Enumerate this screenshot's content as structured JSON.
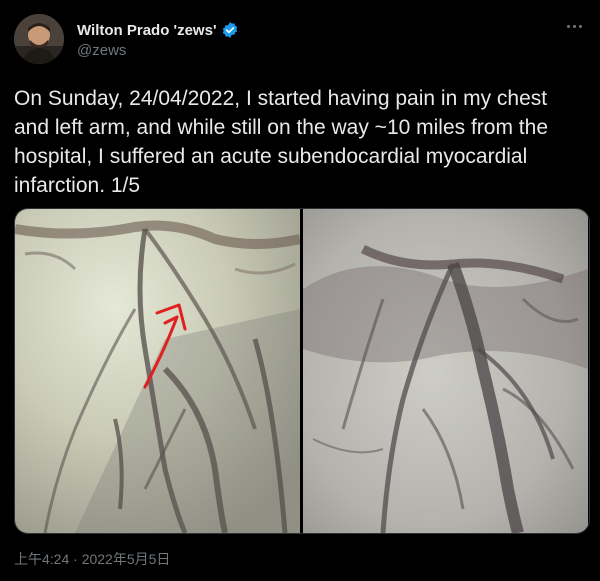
{
  "tweet": {
    "author": {
      "display_name": "Wilton Prado 'zews'",
      "handle": "@zews",
      "verified": true,
      "avatar_icon": "profile-avatar"
    },
    "more_icon": "more-horizontal-icon",
    "text": "On Sunday, 24/04/2022, I started having pain in my chest and left arm, and while still on the way ~10 miles from the hospital, I suffered an acute subendocardial myocardial infarction. 1/5",
    "media": [
      {
        "kind": "angiogram-with-arrow",
        "annotation_color": "#e02020"
      },
      {
        "kind": "angiogram"
      }
    ],
    "timestamp": "上午4:24 · 2022年5月5日"
  },
  "colors": {
    "background": "#000000",
    "text": "#e7e9ea",
    "secondary": "#71767b",
    "verified": "#1d9bf0"
  }
}
